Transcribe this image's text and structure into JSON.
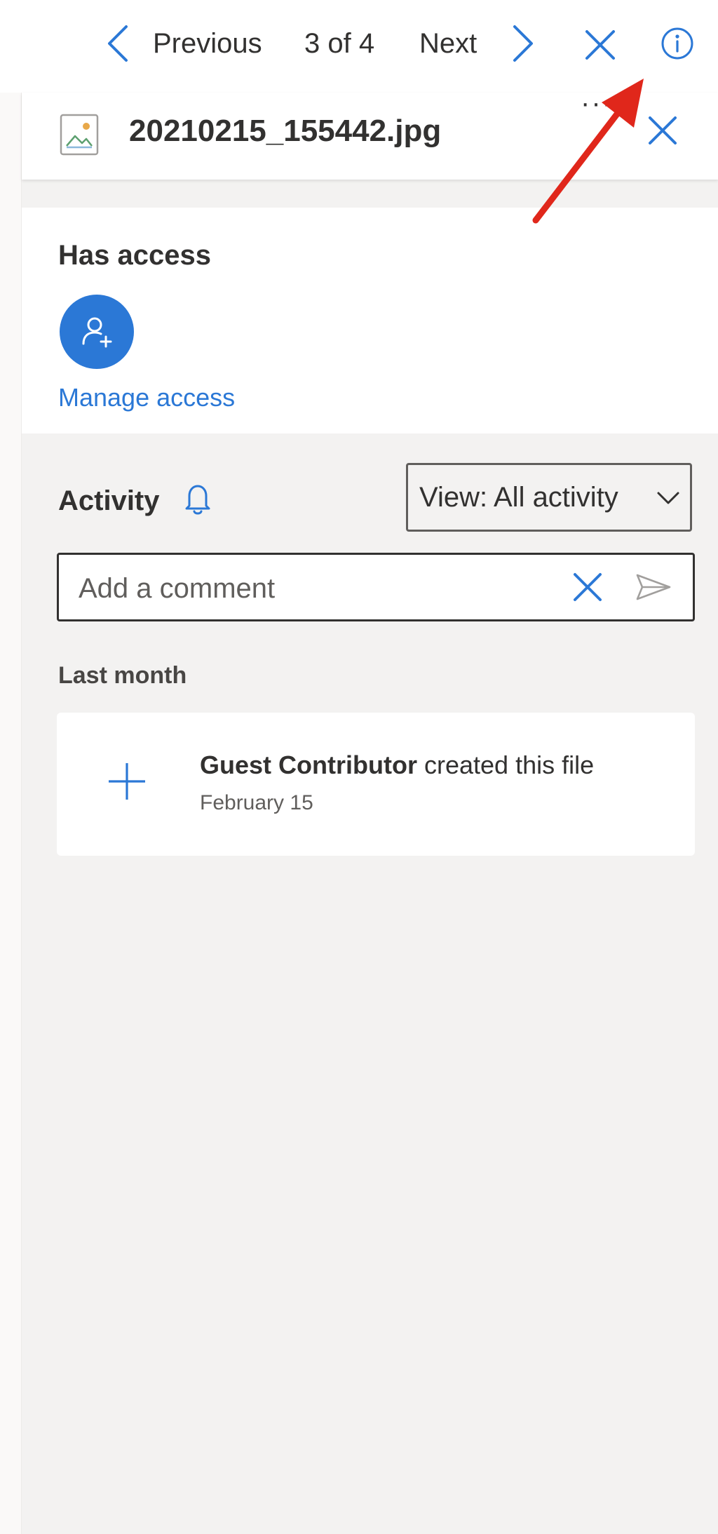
{
  "nav": {
    "previous_label": "Previous",
    "position": "3 of 4",
    "next_label": "Next"
  },
  "file": {
    "name": "20210215_155442.jpg",
    "more_glyph": "···"
  },
  "access": {
    "title": "Has access",
    "manage_link": "Manage access"
  },
  "activity": {
    "title": "Activity",
    "view_filter": "View: All activity",
    "comment_placeholder": "Add a comment",
    "group_label": "Last month",
    "items": [
      {
        "actor": "Guest Contributor",
        "action": "created this file",
        "date": "February 15"
      }
    ]
  },
  "colors": {
    "accent": "#2b78d6",
    "pane_background": "#f3f2f1",
    "annotation_arrow": "#e0271b"
  },
  "icons": {
    "previous": "chevron-left-icon",
    "next": "chevron-right-icon",
    "close_viewer": "close-icon",
    "info": "info-icon",
    "file_type": "image-file-icon",
    "more": "more-icon",
    "close_pane": "close-icon",
    "manage_access": "add-person-icon",
    "notifications": "bell-icon",
    "clear_comment": "close-icon",
    "send": "send-icon",
    "created": "plus-icon"
  }
}
